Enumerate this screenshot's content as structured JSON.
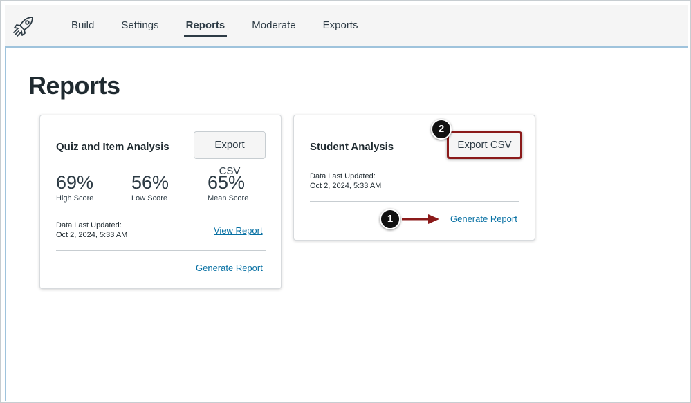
{
  "nav": {
    "items": [
      {
        "label": "Build",
        "active": false
      },
      {
        "label": "Settings",
        "active": false
      },
      {
        "label": "Reports",
        "active": true
      },
      {
        "label": "Moderate",
        "active": false
      },
      {
        "label": "Exports",
        "active": false
      }
    ]
  },
  "page": {
    "title": "Reports"
  },
  "quiz_card": {
    "title": "Quiz and Item Analysis",
    "export_label": "Export CSV",
    "stats": [
      {
        "value": "69%",
        "label": "High Score"
      },
      {
        "value": "56%",
        "label": "Low Score"
      },
      {
        "value": "65%",
        "label": "Mean Score"
      }
    ],
    "updated_label": "Data Last Updated:",
    "updated_value": "Oct 2, 2024, 5:33 AM",
    "view_label": "View Report",
    "generate_label": "Generate Report"
  },
  "student_card": {
    "title": "Student Analysis",
    "export_label": "Export CSV",
    "updated_label": "Data Last Updated:",
    "updated_value": "Oct 2, 2024, 5:33 AM",
    "generate_label": "Generate Report"
  },
  "markers": {
    "one": "1",
    "two": "2"
  },
  "colors": {
    "accent": "#0770a3",
    "highlight": "#8b1a1a",
    "nav_rule": "#9fc3dc"
  },
  "icons": {
    "logo": "rocket-icon"
  }
}
